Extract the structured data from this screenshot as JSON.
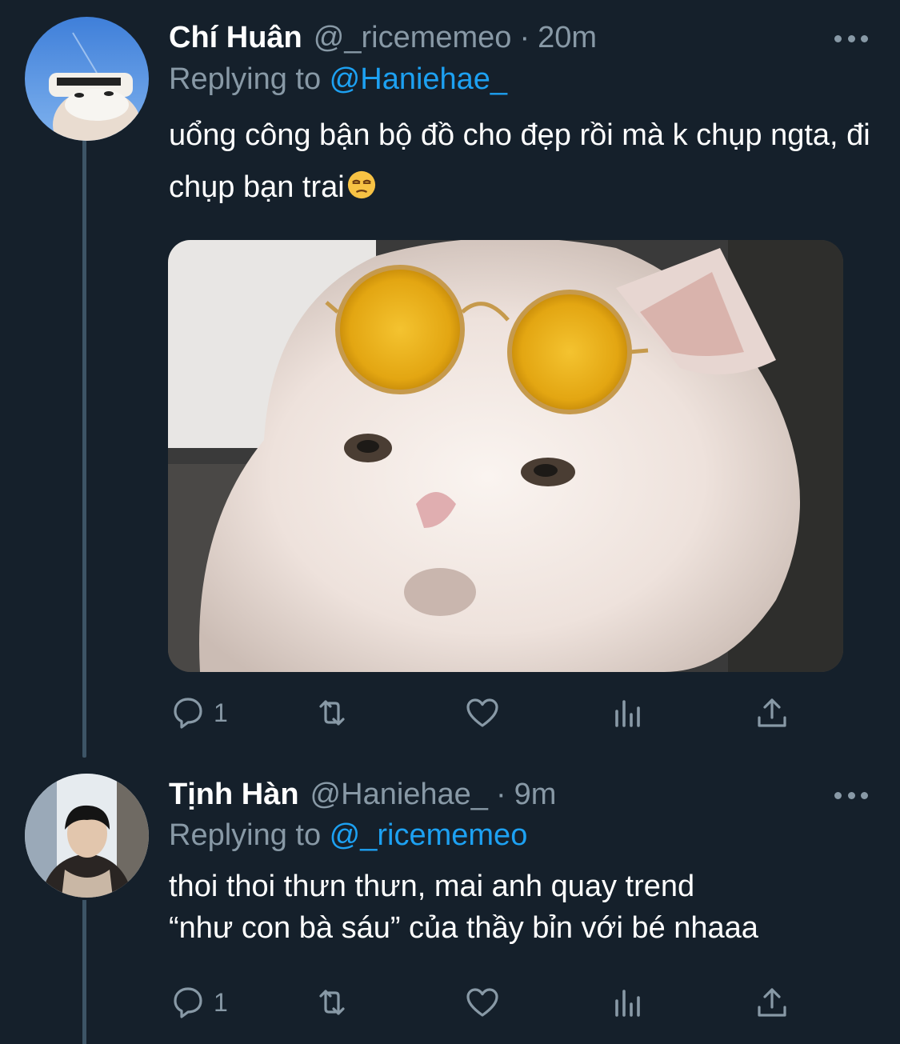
{
  "tweets": [
    {
      "name": "Chí Huân",
      "handle": "@_ricememeo",
      "time": "20m",
      "replying_prefix": "Replying to ",
      "replying_to": "@Haniehae_",
      "text": "uổng công bận bộ đồ cho đẹp rồi mà k chụp ngta, đi chụp bạn trai",
      "emoji": "unamused-face-emoji",
      "reply_count": "1",
      "has_media": true
    },
    {
      "name": "Tịnh Hàn",
      "handle": "@Haniehae_",
      "time": "9m",
      "replying_prefix": "Replying to ",
      "replying_to": "@_ricememeo",
      "text_line1": "thoi thoi thưn thưn, mai anh quay trend",
      "text_line2": "“như con bà sáu” của thầy bỉn với bé nhaaa",
      "reply_count": "1"
    }
  ],
  "separator": "·",
  "colors": {
    "background": "#15202b",
    "secondary_text": "#8899a6",
    "link": "#1da1f2",
    "thread_line": "#3d5466"
  },
  "icons": [
    "reply-icon",
    "retweet-icon",
    "like-icon",
    "analytics-icon",
    "share-icon",
    "more-icon"
  ]
}
